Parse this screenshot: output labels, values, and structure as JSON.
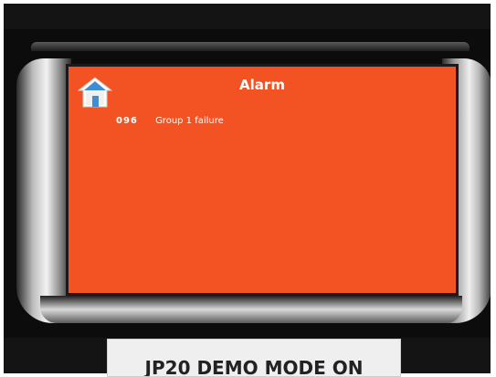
{
  "screen": {
    "title": "Alarm",
    "background_color": "#f35223",
    "home_icon": "home-icon",
    "alarms": [
      {
        "code": "096",
        "description": "Group 1 failure"
      }
    ]
  },
  "device_label": {
    "text": "JP20 DEMO MODE ON"
  }
}
